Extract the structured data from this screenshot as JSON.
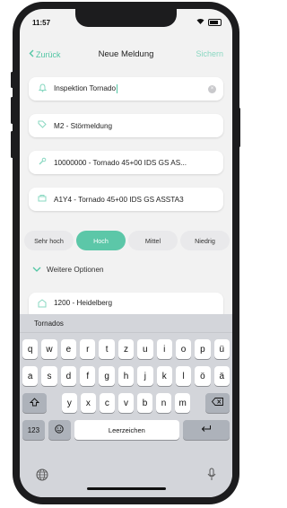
{
  "status": {
    "time": "11:57"
  },
  "nav": {
    "back": "Zurück",
    "title": "Neue Meldung",
    "save": "Sichern"
  },
  "fields": [
    {
      "icon": "bell-icon",
      "text": "Inspektion Tornado"
    },
    {
      "icon": "tag-icon",
      "text": "M2 - Störmeldung"
    },
    {
      "icon": "wrench-icon",
      "text": "10000000 - Tornado 45+00 IDS GS AS..."
    },
    {
      "icon": "equipment-icon",
      "text": "A1Y4 - Tornado 45+00 IDS GS ASSTA3"
    }
  ],
  "priority": {
    "options": [
      "Sehr hoch",
      "Hoch",
      "Mittel",
      "Niedrig"
    ],
    "selected": "Hoch"
  },
  "more_options": "Weitere Optionen",
  "location": "1200 - Heidelberg",
  "keyboard": {
    "suggestion": "Tornados",
    "row1": [
      "q",
      "w",
      "e",
      "r",
      "t",
      "z",
      "u",
      "i",
      "o",
      "p",
      "ü"
    ],
    "row2": [
      "a",
      "s",
      "d",
      "f",
      "g",
      "h",
      "j",
      "k",
      "l",
      "ö",
      "ä"
    ],
    "row3": [
      "y",
      "x",
      "c",
      "v",
      "b",
      "n",
      "m"
    ],
    "numbers_key": "123",
    "space": "Leerzeichen"
  },
  "colors": {
    "accent": "#5cc7a8",
    "accent_light": "#8ad8c2"
  }
}
